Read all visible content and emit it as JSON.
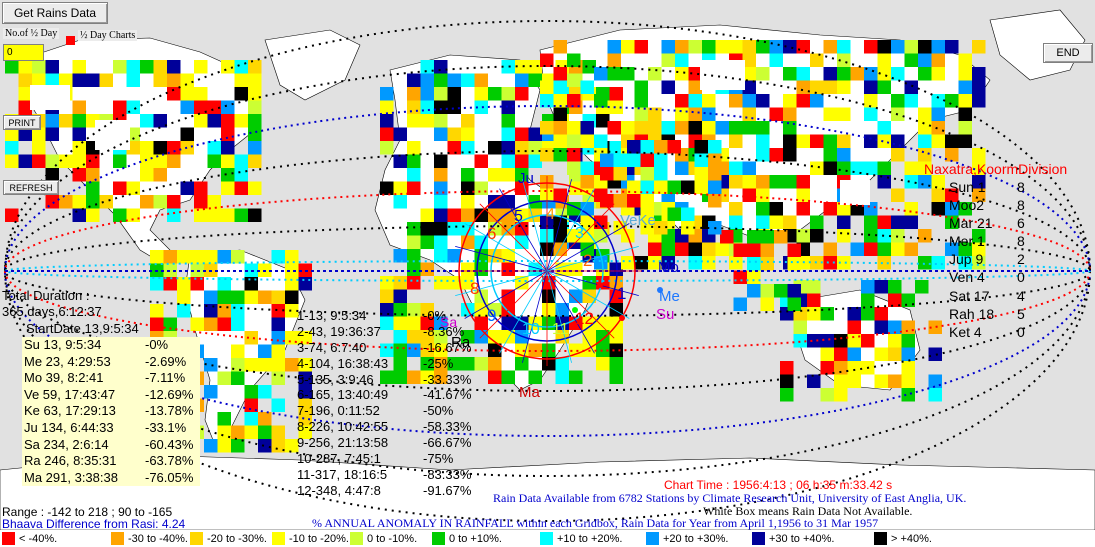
{
  "buttons": {
    "get_rains": "Get Rains Data",
    "charts": "½ Day Charts",
    "print": "PRINT",
    "refresh": "REFRESH",
    "end": "END"
  },
  "no_of_half_day_label": "No.of ½ Day",
  "no_of_half_day_value": "0",
  "total_duration": "Total Duration :",
  "duration_value": "365.days,6:12:37",
  "start_date": "StartDate 13,9:5:34",
  "planets_left": [
    {
      "text": "Su 13, 9:5:34",
      "pct": "-0%"
    },
    {
      "text": "Me 23, 4:29:53",
      "pct": "-2.69%"
    },
    {
      "text": "Mo 39, 8:2:41",
      "pct": "-7.11%"
    },
    {
      "text": "Ve 59, 17:43:47",
      "pct": "-12.69%"
    },
    {
      "text": "Ke 63, 17:29:13",
      "pct": "-13.78%"
    },
    {
      "text": "Ju 134, 6:44:33",
      "pct": "-33.1%"
    },
    {
      "text": "Sa 234, 2:6:14",
      "pct": "-60.43%"
    },
    {
      "text": "Ra 246, 8:35:31",
      "pct": "-63.78%"
    },
    {
      "text": "Ma 291, 3:38:38",
      "pct": "-76.05%"
    }
  ],
  "houses": [
    {
      "text": "1-13, 9:5:34",
      "pct": "-0%"
    },
    {
      "text": "2-43, 19:36:37",
      "pct": "-8.36%"
    },
    {
      "text": "3-74, 6:7:40",
      "pct": "-16.67%"
    },
    {
      "text": "4-104, 16:38:43",
      "pct": "-25%"
    },
    {
      "text": "5-135, 3:9:46",
      "pct": "-33.33%"
    },
    {
      "text": "6-165, 13:40:49",
      "pct": "-41.67%"
    },
    {
      "text": "7-196, 0:11:52",
      "pct": "-50%"
    },
    {
      "text": "8-226, 10:42:55",
      "pct": "-58.33%"
    },
    {
      "text": "9-256, 21:13:58",
      "pct": "-66.67%"
    },
    {
      "text": "10-287, 7:45:1",
      "pct": "-75%"
    },
    {
      "text": "11-317, 18:16:5",
      "pct": "-83.33%"
    },
    {
      "text": "12-348, 4:47:8",
      "pct": "-91.67%"
    }
  ],
  "naxatra": {
    "title": "Naxatra,KoormDivision",
    "rows": [
      {
        "name": "Sun 1",
        "val": "8"
      },
      {
        "name": "Moo2",
        "val": "8"
      },
      {
        "name": "Mar 21",
        "val": "6"
      },
      {
        "name": "Mer 1",
        "val": "8"
      },
      {
        "name": "Jup 9",
        "val": "2"
      },
      {
        "name": "Ven 4",
        "val": "0"
      },
      {
        "name": "Sat 17",
        "val": "4"
      },
      {
        "name": "Rah 18",
        "val": "5"
      },
      {
        "name": "Ket 4",
        "val": "0"
      }
    ]
  },
  "chart_labels": {
    "ju": "Ju",
    "sa": "Sa",
    "ve_ke": "VeKe",
    "mo": "Mo",
    "me": "Me",
    "su": "Su",
    "ra": "Ra",
    "ma": "Ma",
    "h1": "1",
    "h2": "2",
    "h3": "3",
    "h4": "4",
    "h5": "5",
    "h6": "6",
    "h7": "7",
    "h8": "8",
    "h9": "9",
    "h10": "10",
    "h11": "11",
    "h12": "12"
  },
  "chart_time": "Chart Time : 1956:4:13 ; 06 h:35 m:33.42 s",
  "rain_source": "Rain Data Available from 6782 Stations by Climate Research Unit, University of East Anglia, UK.",
  "white_box": "White Box means Rain Data Not Available.",
  "range": "Range : -142 to 218 ; 90 to -165",
  "bhaava": "Bhaava Difference from Rasi: 4.24",
  "anomaly_title": "% ANNUAL ANOMALY IN RAINFALL within each Gridbox, Rain Data for Year from April 1,1956 to 31 Mar 1957",
  "legend": [
    {
      "label": "< -40%.",
      "color": "#ff0000"
    },
    {
      "label": "-30 to -40%.",
      "color": "#ffa500"
    },
    {
      "label": "-20 to -30%.",
      "color": "#ffd700"
    },
    {
      "label": "-10 to -20%.",
      "color": "#ffff00"
    },
    {
      "label": "0 to -10%.",
      "color": "#ccff33"
    },
    {
      "label": "0 to +10%.",
      "color": "#00cc00"
    },
    {
      "label": "+10 to +20%.",
      "color": "#00ffff"
    },
    {
      "label": "+20 to +30%.",
      "color": "#0099ff"
    },
    {
      "label": "+30 to +40%.",
      "color": "#000099"
    },
    {
      "label": "> +40%.",
      "color": "#000000"
    }
  ],
  "colors": {
    "ocean": "#e1e1e1",
    "land": "#ffffff",
    "red_text": "#ff0000",
    "blue_text": "#0000cc",
    "magenta": "#ff00ff"
  }
}
